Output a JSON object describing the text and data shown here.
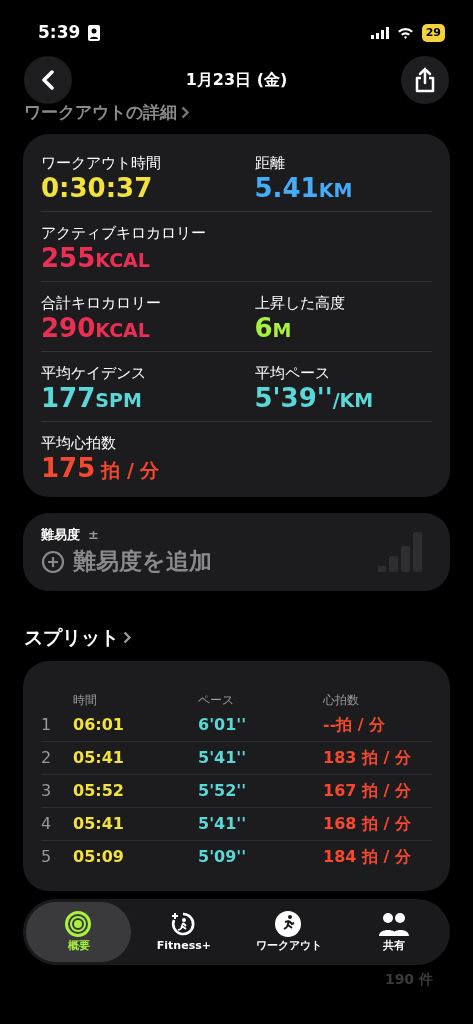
{
  "status_bar": {
    "time": "5:39",
    "battery": "29"
  },
  "nav": {
    "title": "1月23日 (金)"
  },
  "details": {
    "heading": "ワークアウトの詳細",
    "rows": [
      [
        {
          "label": "ワークアウト時間",
          "value": "0:30:37",
          "color": "#f3e23b"
        },
        {
          "label": "距離",
          "value": "5.41",
          "unit": "KM",
          "color": "#45acf7"
        }
      ],
      [
        {
          "label": "アクティブキロカロリー",
          "value": "255",
          "unit": "KCAL",
          "color": "#ea2f55"
        }
      ],
      [
        {
          "label": "合計キロカロリー",
          "value": "290",
          "unit": "KCAL",
          "color": "#ea2f55"
        },
        {
          "label": "上昇した高度",
          "value": "6",
          "unit": "M",
          "color": "#a8f23f"
        }
      ],
      [
        {
          "label": "平均ケイデンス",
          "value": "177",
          "unit": "SPM",
          "color": "#5ad8d8"
        },
        {
          "label": "平均ペース",
          "value": "5'39''",
          "unit": "/KM",
          "color": "#5ad8d8"
        }
      ],
      [
        {
          "label": "平均心拍数",
          "value": "175",
          "unit": "拍 / 分",
          "color": "#f4492f"
        }
      ]
    ]
  },
  "difficulty": {
    "label": "難易度",
    "sign": "±",
    "action": "難易度を追加"
  },
  "splits": {
    "heading": "スプリット",
    "columns": [
      "時間",
      "ペース",
      "心拍数"
    ],
    "rows": [
      {
        "index": "1",
        "time": "06:01",
        "pace": "6'01''",
        "heart": "--拍 / 分"
      },
      {
        "index": "2",
        "time": "05:41",
        "pace": "5'41''",
        "heart": "183 拍 / 分"
      },
      {
        "index": "3",
        "time": "05:52",
        "pace": "5'52''",
        "heart": "167 拍 / 分"
      },
      {
        "index": "4",
        "time": "05:41",
        "pace": "5'41''",
        "heart": "168 拍 / 分"
      },
      {
        "index": "5",
        "time": "05:09",
        "pace": "5'09''",
        "heart": "184 拍 / 分"
      }
    ]
  },
  "tabs": [
    {
      "label": "概要",
      "kind": "rings",
      "selected": true
    },
    {
      "label": "Fitness+",
      "kind": "fitness",
      "selected": false
    },
    {
      "label": "ワークアウト",
      "kind": "runner",
      "selected": false
    },
    {
      "label": "共有",
      "kind": "people",
      "selected": false
    }
  ],
  "footer_count": "190 件"
}
